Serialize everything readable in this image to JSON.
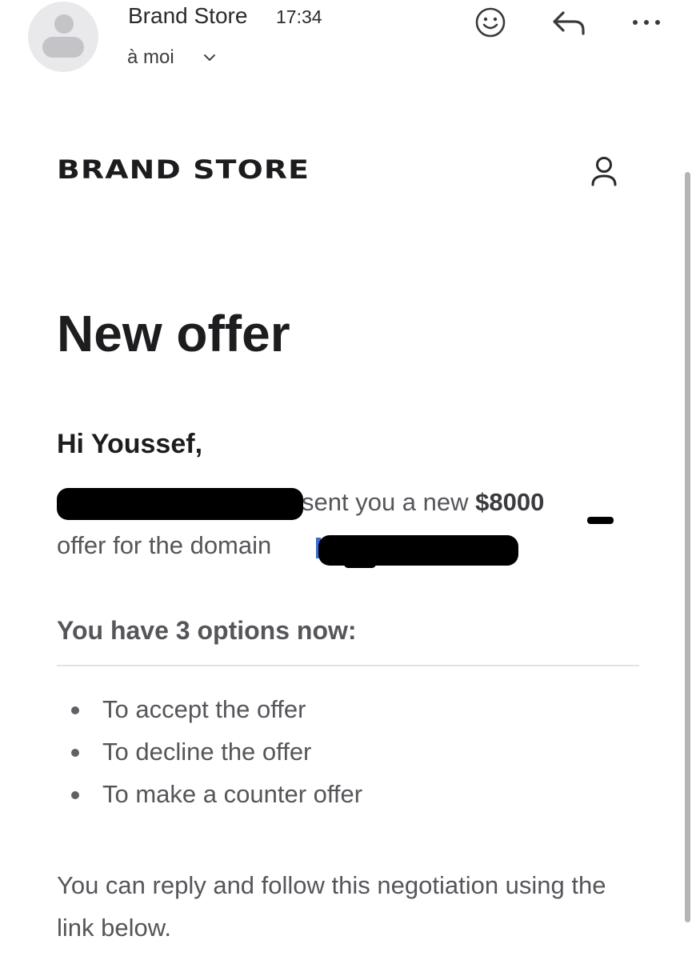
{
  "mail_header": {
    "sender": "Brand Store",
    "time": "17:34",
    "recipient": "à moi"
  },
  "email": {
    "brand_logo": "BRAND STORE",
    "title": "New offer",
    "greeting": "Hi Youssef,",
    "offer_text_start": "sent you a new ",
    "offer_amount": "$8000",
    "offer_text_line2": "offer for the domain",
    "options_heading": "You have 3 options now:",
    "options": [
      "To accept the offer",
      "To decline the offer",
      "To make a counter offer"
    ],
    "footer_text": "You can reply and follow this negotiation using the link below."
  },
  "colors": {
    "link": "#3d6bd3",
    "body_text": "#55565a",
    "heading": "#1d1d1f"
  },
  "icons": [
    "avatar-icon",
    "chevron-down-icon",
    "emoji-icon",
    "reply-icon",
    "more-icon",
    "account-icon"
  ]
}
